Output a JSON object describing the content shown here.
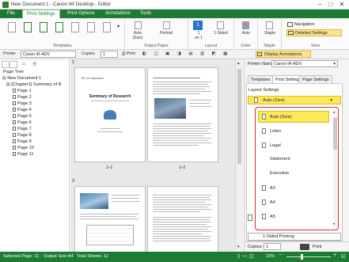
{
  "window": {
    "title": "New Document 1 - Canon iW Desktop - Editor"
  },
  "ribbon_tabs": [
    "File",
    "Print Settings",
    "Print Options",
    "Annotations",
    "Tools"
  ],
  "ribbon": {
    "templates_label": "Templates",
    "output_paper_label": "Output Paper",
    "layout_label": "Layout",
    "color_label": "Color",
    "staple_label": "Staple",
    "view_label": "View",
    "auto_size": "Auto\n(Size)",
    "portrait": "Portrait",
    "one_on_one": "1\non 1",
    "one_sided": "1-Sided",
    "auto_color": "Auto",
    "staple_btn": "Staple",
    "navigation": "Navigation",
    "detailed_settings": "Detailed Settings"
  },
  "toolbar": {
    "printer_label": "Printer",
    "printer_value": "Canon iR-ADV",
    "copies_label": "Copies",
    "copies_value": "1",
    "print_label": "Print",
    "display_annotations": "Display Annotations"
  },
  "leftpane": {
    "header": "Page Tree",
    "root": "New Document 1",
    "chapter": "[Chapter1] Summary of R",
    "pages": [
      "Page 1",
      "Page 2",
      "Page 3",
      "Page 4",
      "Page 5",
      "Page 6",
      "Page 7",
      "Page 8",
      "Page 9",
      "Page 10",
      "Page 11"
    ]
  },
  "center": {
    "row1_number": "1",
    "row2_number": "3",
    "label_1_1": "1–1",
    "label_1_2": "1–2",
    "page_title": "Summary of Research",
    "page_small_header": "Re: 40 Inspection"
  },
  "rightpane": {
    "printer_name_label": "Printer Name",
    "printer_name_value": "Canon iR-ADV",
    "tabs": [
      "Templates",
      "Print Settings",
      "Page Settings"
    ],
    "layout_settings_label": "Layout Settings",
    "selected_size": "Auto (Size)",
    "size_options": [
      "Auto (Size)",
      "Letter",
      "Legal",
      "Statement",
      "Executive",
      "A3",
      "A4",
      "A5"
    ],
    "sided_printing": "1-Sided Printing",
    "copies_label": "Copies:",
    "copies_value": "1",
    "print_label": "Print"
  },
  "statusbar": {
    "selected_page": "Selected Page :11",
    "output_size": "Output Size:A4",
    "total_sheets": "Total Sheets: 11",
    "zoom": "23%"
  },
  "colors": {
    "brand": "#1e7b34",
    "highlight": "#fde85a",
    "dropdown_border": "#d32f2f"
  }
}
